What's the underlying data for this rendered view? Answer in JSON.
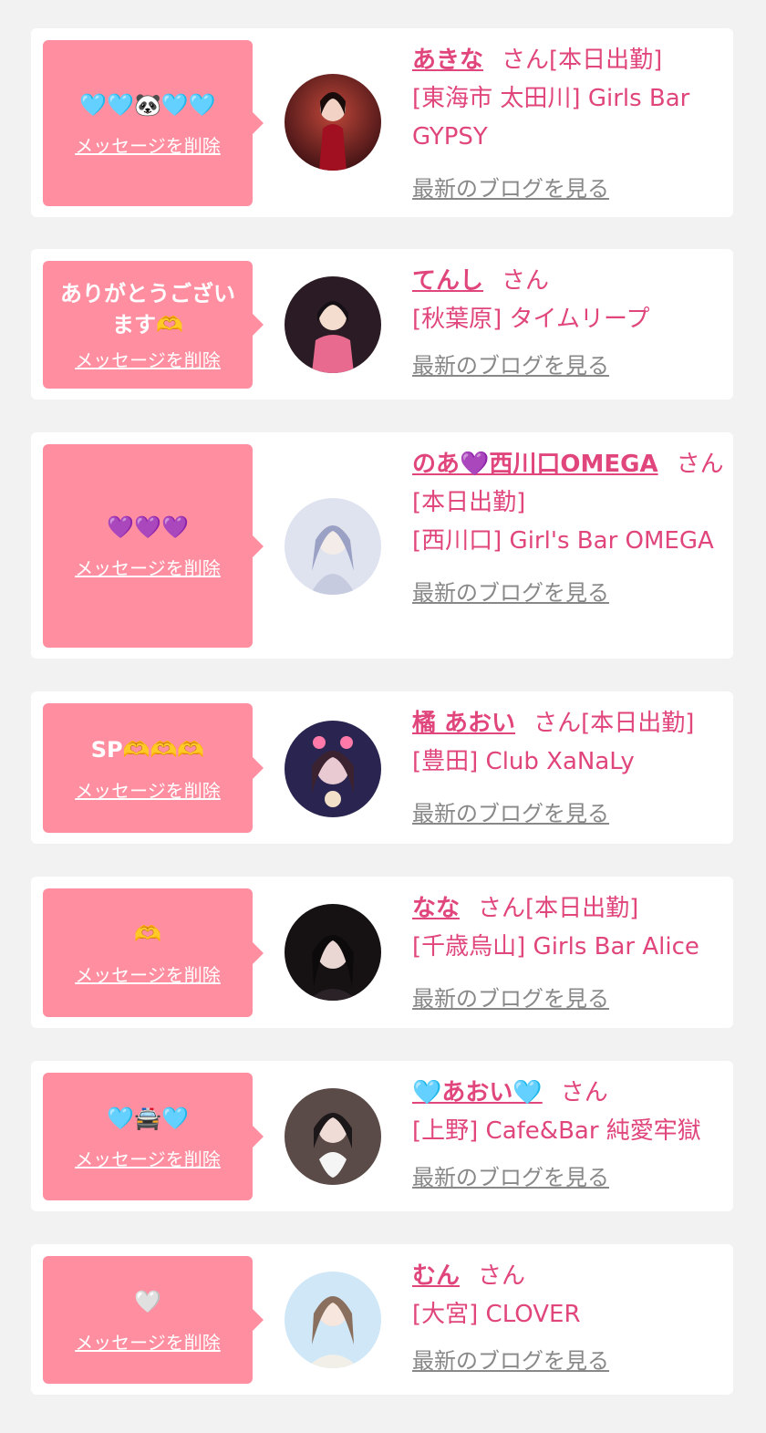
{
  "common": {
    "delete_label": "メッセージを削除",
    "blog_label": "最新のブログを見る"
  },
  "colors": {
    "background": "#f2f2f2",
    "bubble": "#ff8fa0",
    "accent": "#e0457b",
    "link_gray": "#888888"
  },
  "entries": [
    {
      "message": "🩵🩵🐼🩵🩵",
      "name": "あきな",
      "suffix": "さん[本日出勤]",
      "shop": "[東海市 太田川] Girls Bar GYPSY"
    },
    {
      "message": "ありがとうございます🫶",
      "name": "てんし",
      "suffix": "さん",
      "shop": "[秋葉原] タイムリープ"
    },
    {
      "message": "💜💜💜",
      "name": "のあ💜西川口OMEGA",
      "suffix": "さん[本日出勤]",
      "shop": "[西川口] Girl's Bar OMEGA"
    },
    {
      "message": "SP🫶🫶🫶",
      "name": "橘 あおい",
      "suffix": "さん[本日出勤]",
      "shop": "[豊田] Club XaNaLy"
    },
    {
      "message": "🫶",
      "name": "なな",
      "suffix": "さん[本日出勤]",
      "shop": "[千歳烏山] Girls Bar Alice"
    },
    {
      "message": "🩵🚔🩵",
      "name": "🩵あおい🩵",
      "suffix": "さん",
      "shop": "[上野] Cafe&Bar 純愛牢獄"
    },
    {
      "message": "🤍",
      "name": "むん",
      "suffix": "さん",
      "shop": "[大宮] CLOVER"
    }
  ]
}
